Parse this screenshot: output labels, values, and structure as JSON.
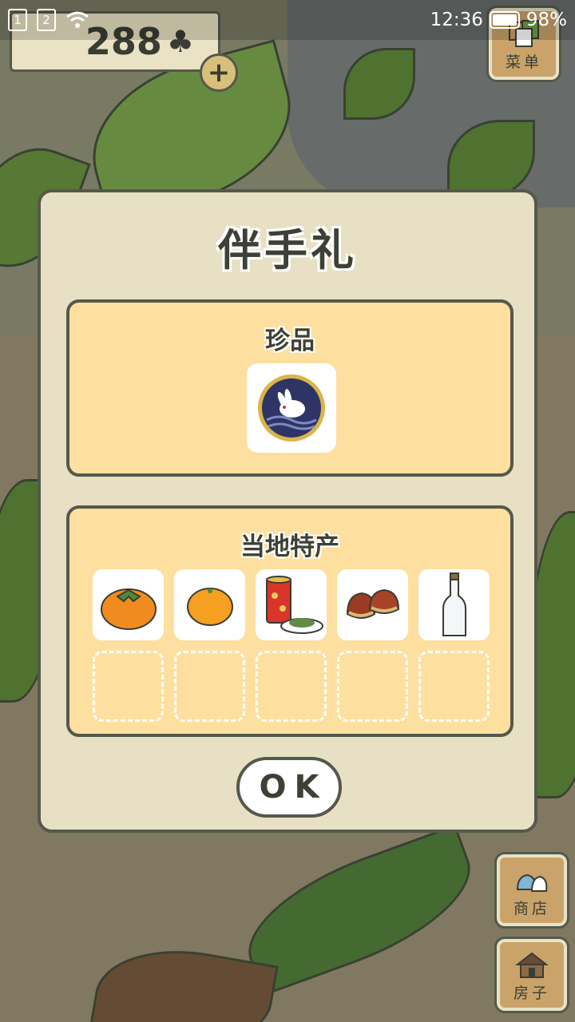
{
  "status_bar": {
    "sim1": "1",
    "sim2": "2",
    "time": "12:36",
    "battery": "98%"
  },
  "counter": {
    "value": "288",
    "icon": "clover-icon",
    "add_icon": "plus-icon"
  },
  "menu_button": {
    "label": "菜单",
    "icon": "menu-cards-icon"
  },
  "shop_button": {
    "label": "商店",
    "icon": "shop-bags-icon"
  },
  "house_button": {
    "label": "房子",
    "icon": "house-icon"
  },
  "dialog": {
    "title": "伴手礼",
    "rare_section": {
      "title": "珍品",
      "item": {
        "icon": "rabbit-plate-icon"
      }
    },
    "local_section": {
      "title": "当地特产",
      "items": [
        {
          "icon": "persimmon-icon"
        },
        {
          "icon": "orange-icon"
        },
        {
          "icon": "tea-can-and-plate-icon"
        },
        {
          "icon": "chestnuts-icon"
        },
        {
          "icon": "glass-bottle-icon"
        }
      ],
      "empty_slots": 5
    },
    "ok_label": "OK"
  },
  "colors": {
    "panel_bg": "#e8e0c4",
    "section_bg": "#fde0a0",
    "outline": "#55594b",
    "text": "#3d4135"
  }
}
